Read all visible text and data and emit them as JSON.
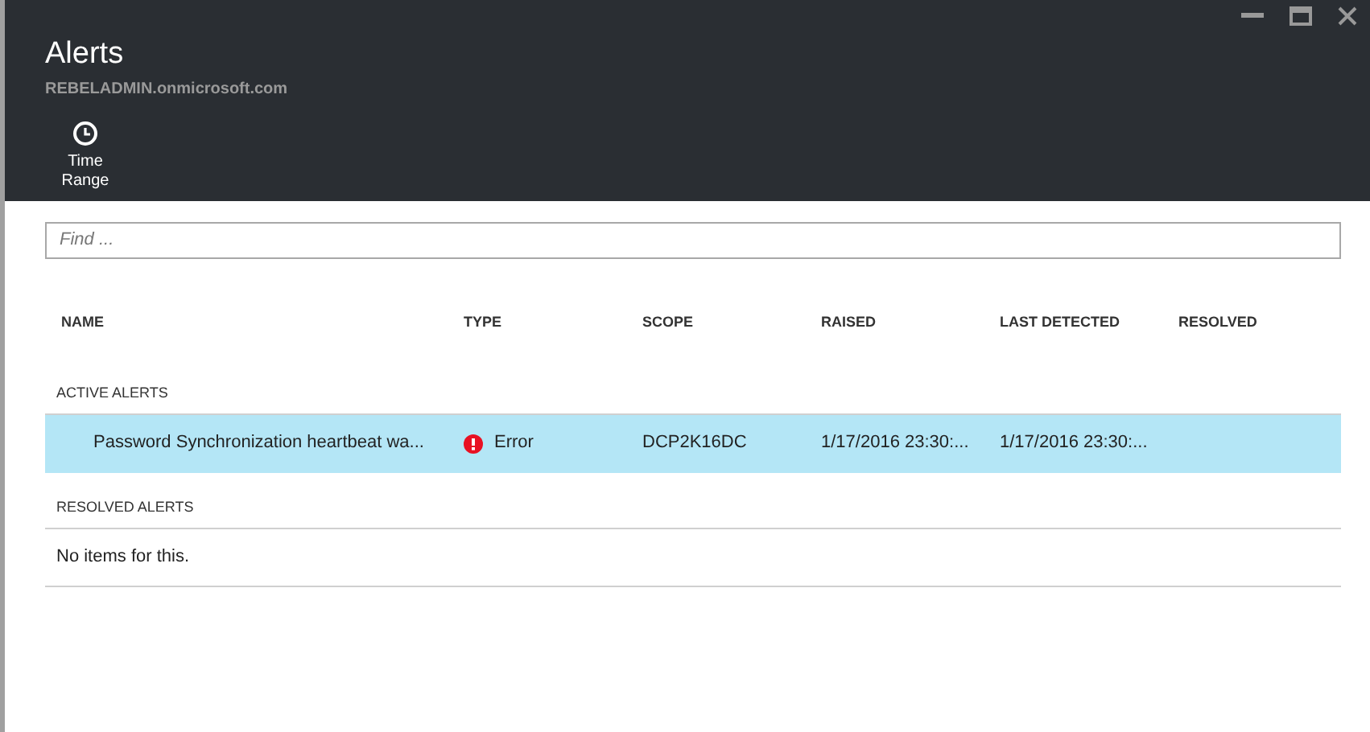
{
  "window": {
    "title": "Alerts",
    "subtitle": "REBELADMIN.onmicrosoft.com"
  },
  "toolbar": [
    {
      "label": "Time Range",
      "kind": "clock"
    }
  ],
  "search": {
    "placeholder": "Find ..."
  },
  "table": {
    "columns": [
      "NAME",
      "TYPE",
      "SCOPE",
      "RAISED",
      "LAST DETECTED",
      "RESOLVED"
    ],
    "sections": [
      {
        "title": "ACTIVE ALERTS",
        "rows": [
          {
            "selected": true,
            "name": "Password Synchronization heartbeat wa...",
            "type": "Error",
            "kind": "error",
            "scope": "DCP2K16DC",
            "raised": "1/17/2016 23:30:...",
            "last_detected": "1/17/2016 23:30:..."
          }
        ]
      },
      {
        "title": "RESOLVED ALERTS",
        "empty_text": "No items for this."
      }
    ]
  }
}
